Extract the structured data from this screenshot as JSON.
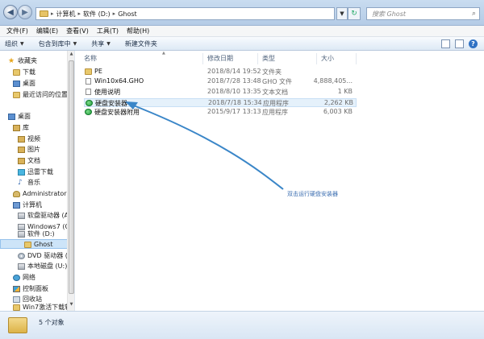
{
  "address": {
    "path": [
      "计算机",
      "软件 (D:)",
      "Ghost"
    ]
  },
  "search": {
    "placeholder": "搜索 Ghost"
  },
  "menu": [
    "文件(F)",
    "编辑(E)",
    "查看(V)",
    "工具(T)",
    "帮助(H)"
  ],
  "toolbar": {
    "organize": "组织",
    "include": "包含到库中",
    "share": "共享",
    "new_folder": "新建文件夹"
  },
  "nav": {
    "favorites": "收藏夹",
    "downloads": "下载",
    "desktop_fav": "桌面",
    "recent": "最近访问的位置",
    "desktop": "桌面",
    "libraries": "库",
    "videos": "视频",
    "pictures": "图片",
    "documents": "文档",
    "thunder": "迅雷下载",
    "music": "音乐",
    "admin": "Administrator",
    "computer": "计算机",
    "floppy": "软盘驱动器 (A:",
    "windows7": "Windows7 (C:",
    "software": "软件 (D:)",
    "ghost": "Ghost",
    "dvd": "DVD 驱动器 (F",
    "local_disk": "本地磁盘 (U:)",
    "network": "网络",
    "control_panel": "控制面板",
    "recycle": "回收站",
    "win7": "Win7激活下载软"
  },
  "columns": {
    "name": "名称",
    "date": "修改日期",
    "type": "类型",
    "size": "大小"
  },
  "files": [
    {
      "name": "PE",
      "date": "2018/8/14 19:52",
      "type": "文件夹",
      "size": "",
      "icon": "folder-icon"
    },
    {
      "name": "Win10x64.GHO",
      "date": "2018/7/28 13:48",
      "type": "GHO 文件",
      "size": "4,888,405...",
      "icon": "file-icon"
    },
    {
      "name": "使用说明",
      "date": "2018/8/10 13:35",
      "type": "文本文档",
      "size": "1 KB",
      "icon": "file-icon"
    },
    {
      "name": "硬盘安装器",
      "date": "2018/7/18 15:34",
      "type": "应用程序",
      "size": "2,262 KB",
      "icon": "app-icon"
    },
    {
      "name": "硬盘安装器附用",
      "date": "2015/9/17 13:13",
      "type": "应用程序",
      "size": "6,003 KB",
      "icon": "app-icon"
    }
  ],
  "annotation": "双击运行硬盘安装器",
  "status": {
    "count": "5 个对象"
  },
  "colors": {
    "accent": "#2f72c4",
    "arrow": "#3a86c8",
    "selection": "#e5f1fb"
  }
}
